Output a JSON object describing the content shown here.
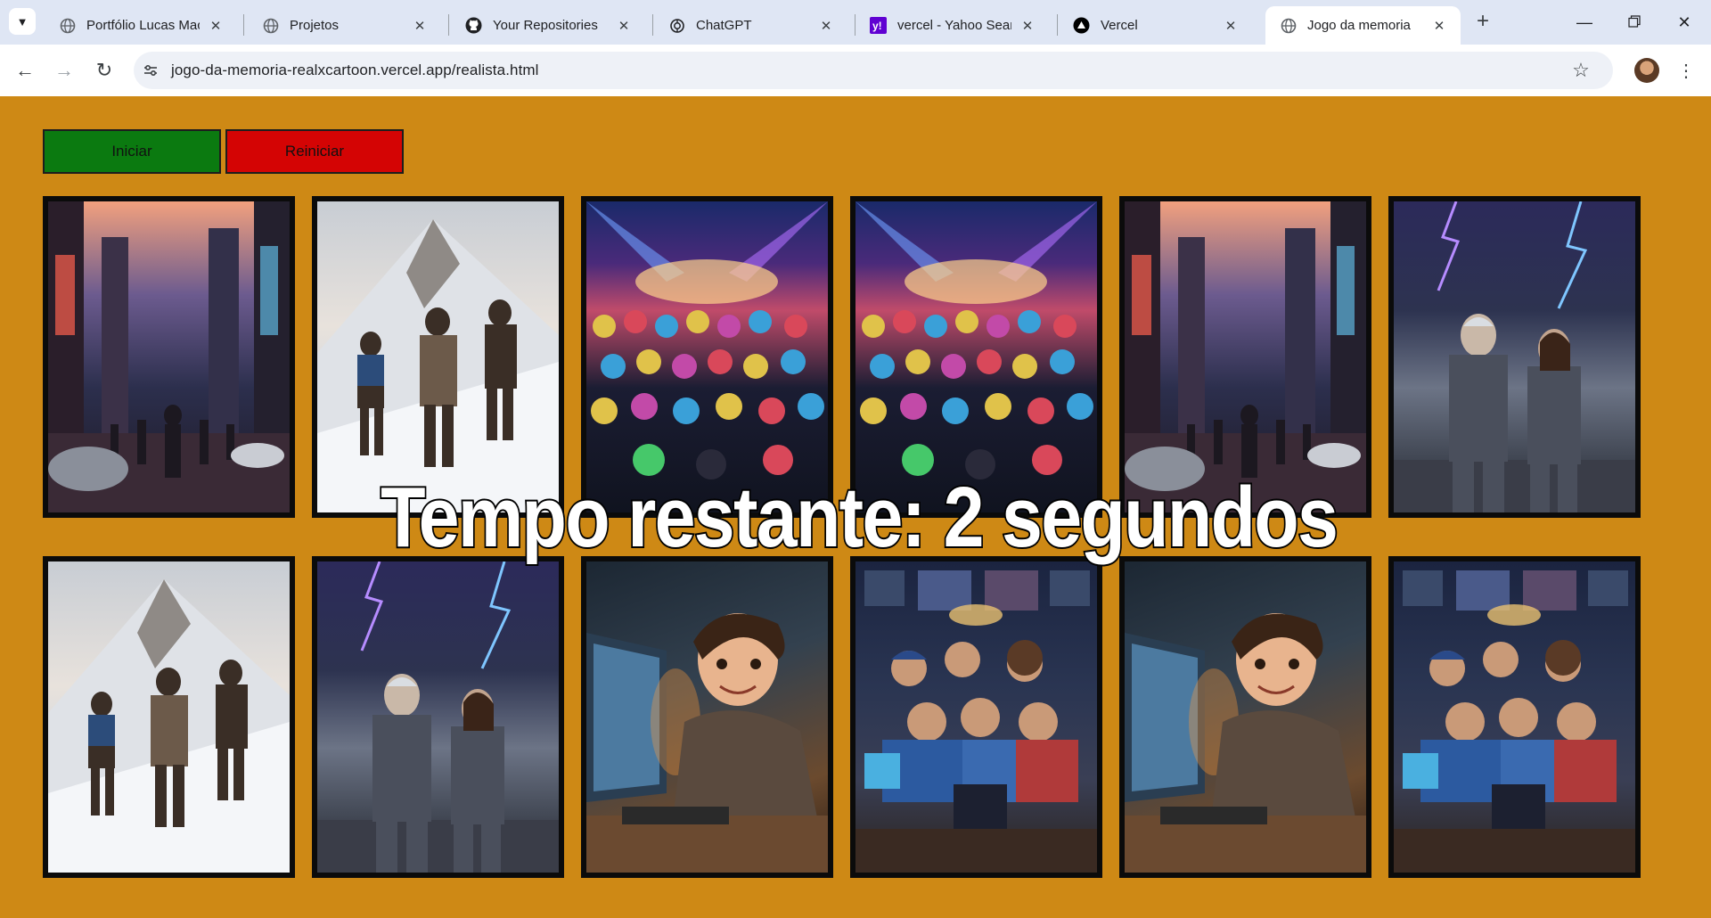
{
  "browser": {
    "tabs": [
      {
        "title": "Portfólio Lucas Mach",
        "icon": "globe-icon",
        "active": false
      },
      {
        "title": "Projetos",
        "icon": "globe-icon",
        "active": false
      },
      {
        "title": "Your Repositories",
        "icon": "github-icon",
        "active": false
      },
      {
        "title": "ChatGPT",
        "icon": "openai-icon",
        "active": false
      },
      {
        "title": "vercel - Yahoo Searc",
        "icon": "yahoo-icon",
        "active": false
      },
      {
        "title": "Vercel",
        "icon": "vercel-icon",
        "active": false
      },
      {
        "title": "Jogo da memoria",
        "icon": "globe-icon",
        "active": true
      }
    ],
    "url": "jogo-da-memoria-realxcartoon.vercel.app/realista.html"
  },
  "game": {
    "start_label": "Iniciar",
    "restart_label": "Reiniciar",
    "timer_text": "Tempo restante: 2 segundos",
    "cards": [
      {
        "scene": "cyberpunk-city-robots"
      },
      {
        "scene": "mountain-climbers"
      },
      {
        "scene": "masked-concert-crowd"
      },
      {
        "scene": "masked-concert-crowd"
      },
      {
        "scene": "cyberpunk-city-robots"
      },
      {
        "scene": "armored-heroes-lightning"
      },
      {
        "scene": "mountain-climbers"
      },
      {
        "scene": "armored-heroes-lightning"
      },
      {
        "scene": "boy-at-computer"
      },
      {
        "scene": "gamers-room"
      },
      {
        "scene": "boy-at-computer"
      },
      {
        "scene": "gamers-room"
      }
    ]
  },
  "colors": {
    "page_background": "#ce8915",
    "start_button": "#0b7a10",
    "restart_button": "#d40404",
    "tabstrip": "#dfe6f4"
  }
}
